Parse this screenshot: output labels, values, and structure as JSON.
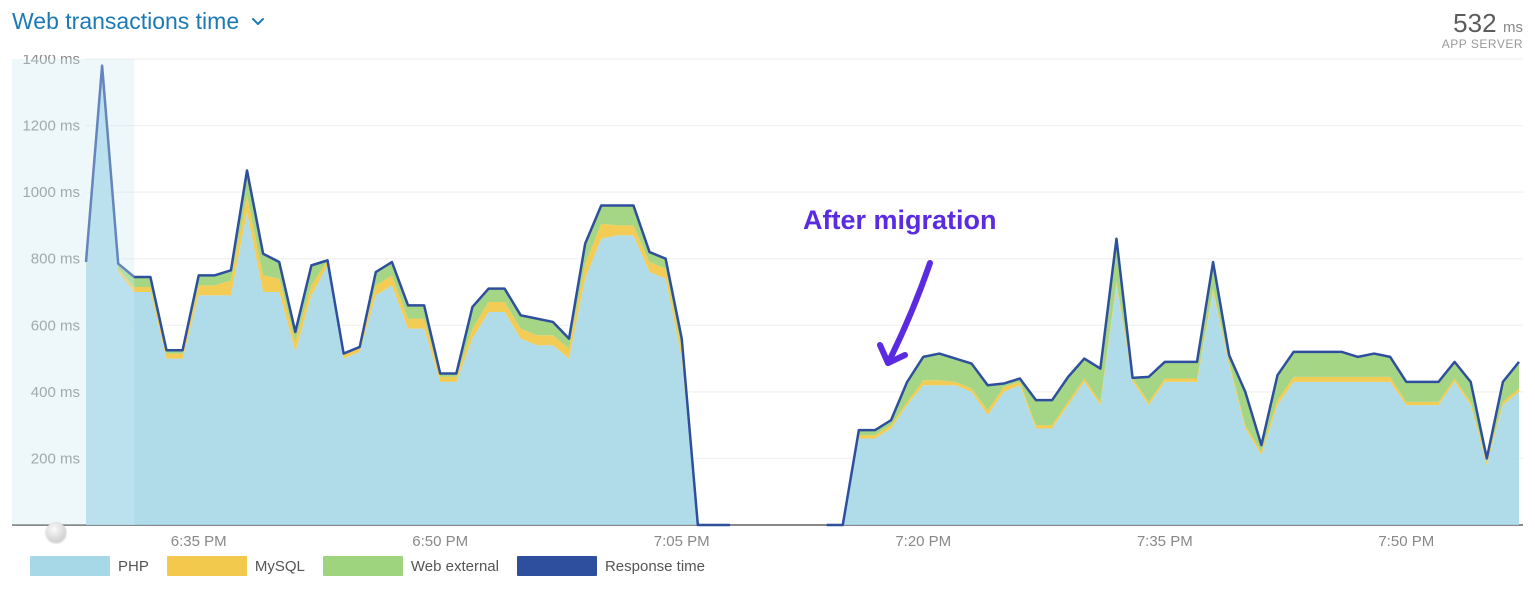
{
  "header": {
    "title": "Web transactions time",
    "metric_value": "532",
    "metric_unit": "ms",
    "metric_label": "APP SERVER"
  },
  "annotation": {
    "text": "After migration"
  },
  "legend": [
    {
      "label": "PHP",
      "color": "#a7d8e8"
    },
    {
      "label": "MySQL",
      "color": "#f2c94c"
    },
    {
      "label": "Web external",
      "color": "#9fd47f"
    },
    {
      "label": "Response time",
      "color": "#2e4f9e"
    }
  ],
  "chart_data": {
    "type": "area",
    "title": "Web transactions time",
    "xlabel": "",
    "ylabel": "ms",
    "ylim": [
      0,
      1400
    ],
    "y_ticks": [
      200,
      400,
      600,
      800,
      1000,
      1200,
      1400
    ],
    "x_ticks": [
      "6:35 PM",
      "6:50 PM",
      "7:05 PM",
      "7:20 PM",
      "7:35 PM",
      "7:50 PM"
    ],
    "legend_position": "bottom",
    "grid": "horizontal",
    "gap_between_minutes": [
      38,
      44
    ],
    "x_minutes_since_630": [
      -2,
      -1,
      0,
      1,
      2,
      3,
      4,
      5,
      6,
      7,
      8,
      9,
      10,
      11,
      12,
      13,
      14,
      15,
      16,
      17,
      18,
      19,
      20,
      21,
      22,
      23,
      24,
      25,
      26,
      27,
      28,
      29,
      30,
      31,
      32,
      33,
      34,
      35,
      36,
      37,
      38,
      44,
      45,
      46,
      47,
      48,
      49,
      50,
      51,
      52,
      53,
      54,
      55,
      56,
      57,
      58,
      59,
      60,
      61,
      62,
      63,
      64,
      65,
      66,
      67,
      68,
      69,
      70,
      71,
      72,
      73,
      74,
      75,
      76,
      77,
      78,
      79,
      80,
      81,
      82,
      83,
      84,
      85,
      86,
      87
    ],
    "series": [
      {
        "name": "PHP",
        "color": "#a7d8e8",
        "values": [
          770,
          1380,
          760,
          700,
          700,
          500,
          500,
          690,
          690,
          690,
          940,
          700,
          700,
          520,
          690,
          780,
          500,
          520,
          690,
          720,
          590,
          590,
          430,
          430,
          560,
          640,
          640,
          560,
          540,
          540,
          500,
          740,
          860,
          870,
          870,
          760,
          740,
          500,
          0,
          0,
          0,
          0,
          0,
          260,
          260,
          290,
          360,
          420,
          420,
          420,
          400,
          330,
          400,
          420,
          290,
          290,
          360,
          430,
          360,
          720,
          432,
          360,
          430,
          430,
          430,
          700,
          480,
          290,
          210,
          360,
          430,
          430,
          430,
          430,
          430,
          430,
          430,
          360,
          360,
          360,
          430,
          360,
          180,
          360,
          400
        ]
      },
      {
        "name": "MySQL",
        "color": "#f2c94c",
        "values": [
          10,
          0,
          10,
          15,
          15,
          15,
          15,
          30,
          30,
          45,
          50,
          50,
          40,
          30,
          30,
          15,
          15,
          15,
          30,
          30,
          30,
          30,
          15,
          15,
          30,
          30,
          30,
          30,
          30,
          30,
          30,
          45,
          45,
          30,
          30,
          30,
          30,
          30,
          0,
          0,
          0,
          0,
          0,
          10,
          10,
          10,
          10,
          15,
          15,
          10,
          10,
          15,
          15,
          10,
          10,
          10,
          10,
          10,
          10,
          10,
          10,
          10,
          10,
          10,
          10,
          10,
          10,
          10,
          10,
          15,
          15,
          15,
          15,
          15,
          15,
          15,
          15,
          10,
          10,
          10,
          10,
          10,
          10,
          10,
          10
        ]
      },
      {
        "name": "Web external",
        "color": "#9fd47f",
        "values": [
          10,
          0,
          15,
          30,
          30,
          10,
          10,
          30,
          30,
          30,
          75,
          65,
          50,
          30,
          60,
          0,
          0,
          0,
          40,
          40,
          40,
          40,
          10,
          10,
          65,
          40,
          40,
          40,
          50,
          40,
          30,
          60,
          55,
          60,
          60,
          30,
          30,
          30,
          0,
          0,
          0,
          0,
          0,
          15,
          15,
          15,
          60,
          70,
          80,
          70,
          75,
          75,
          10,
          10,
          75,
          75,
          75,
          60,
          100,
          130,
          0,
          75,
          50,
          50,
          50,
          80,
          20,
          100,
          20,
          75,
          75,
          75,
          75,
          75,
          60,
          70,
          60,
          60,
          60,
          60,
          50,
          60,
          10,
          60,
          80
        ]
      }
    ],
    "response_time_line": {
      "name": "Response time",
      "color": "#2e4f9e",
      "values": [
        790,
        1380,
        785,
        745,
        745,
        525,
        525,
        750,
        750,
        765,
        1065,
        815,
        790,
        580,
        780,
        795,
        515,
        535,
        760,
        790,
        660,
        660,
        455,
        455,
        655,
        710,
        710,
        630,
        620,
        610,
        560,
        845,
        960,
        960,
        960,
        820,
        800,
        560,
        0,
        0,
        0,
        0,
        0,
        285,
        285,
        315,
        430,
        505,
        515,
        500,
        485,
        420,
        425,
        440,
        375,
        375,
        445,
        500,
        470,
        860,
        442,
        445,
        490,
        490,
        490,
        790,
        510,
        400,
        240,
        450,
        520,
        520,
        520,
        520,
        505,
        515,
        505,
        430,
        430,
        430,
        490,
        430,
        200,
        430,
        490
      ]
    }
  }
}
